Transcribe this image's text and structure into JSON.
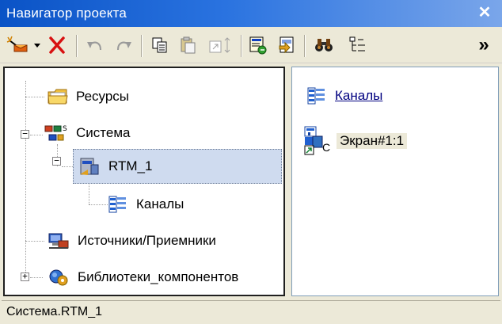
{
  "window": {
    "title": "Навигатор проекта",
    "close_glyph": "✕"
  },
  "toolbar": {
    "buttons": [
      {
        "icon": "wand-icon"
      },
      {
        "icon": "dropdown-arrow-icon"
      },
      {
        "icon": "delete-icon"
      },
      {
        "icon": "undo-icon"
      },
      {
        "icon": "redo-icon"
      },
      {
        "icon": "copy-icon"
      },
      {
        "icon": "paste-icon"
      },
      {
        "icon": "resize-icon"
      },
      {
        "icon": "properties-icon"
      },
      {
        "icon": "export-icon"
      },
      {
        "icon": "binoculars-icon"
      },
      {
        "icon": "tree-view-icon"
      },
      {
        "icon": "more-icon"
      }
    ],
    "more_glyph": "»"
  },
  "tree": {
    "resources": "Ресурсы",
    "system": "Система",
    "rtm": "RTM_1",
    "channels": "Каналы",
    "sources": "Источники/Приемники",
    "libraries": "Библиотеки_компонентов",
    "minus": "−",
    "plus": "+"
  },
  "list": {
    "channels_link": "Каналы",
    "screen_item": "Экран#1:1",
    "screen_suffix": "C"
  },
  "status": {
    "path": "Система.RTM_1"
  },
  "colors": {
    "title_start": "#0a53c6",
    "title_end": "#7aa6ea",
    "selection": "#cfdbef",
    "link": "#000080"
  }
}
